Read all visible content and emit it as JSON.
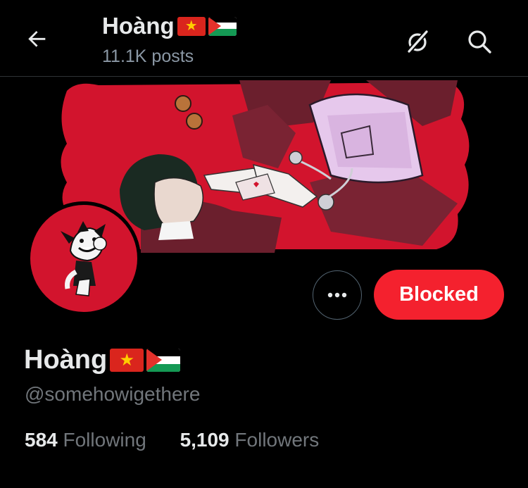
{
  "header": {
    "name": "Hoàng",
    "posts": "11.1K posts",
    "back_icon": "arrow-left-icon",
    "grok_icon": "grok-icon",
    "search_icon": "search-icon"
  },
  "profile": {
    "name": "Hoàng",
    "handle": "@somehowigethere",
    "flags": [
      "vietnam-flag",
      "palestine-flag"
    ],
    "following_count": "584",
    "following_label": "Following",
    "followers_count": "5,109",
    "followers_label": "Followers"
  },
  "actions": {
    "more_icon": "more-options-icon",
    "blocked_label": "Blocked"
  },
  "colors": {
    "background": "#000000",
    "blocked_red": "#f4212e",
    "muted_text": "#71767b",
    "banner_red": "#d2142d"
  }
}
